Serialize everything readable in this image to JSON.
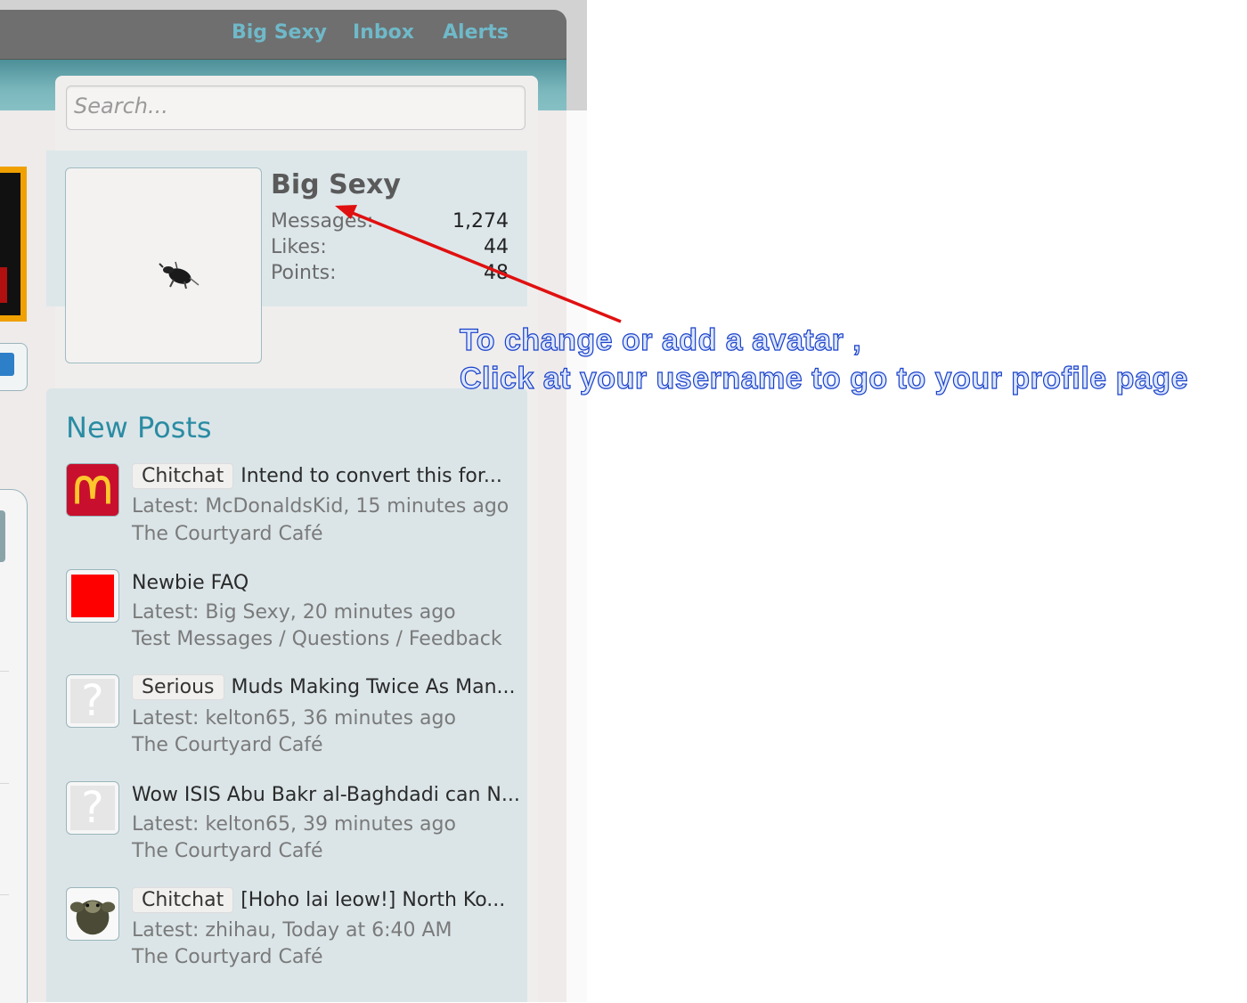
{
  "header": {
    "nav": [
      "Big Sexy",
      "Inbox",
      "Alerts"
    ]
  },
  "search": {
    "placeholder": "Search..."
  },
  "visitor": {
    "username": "Big Sexy",
    "stats": [
      {
        "label": "Messages:",
        "value": "1,274"
      },
      {
        "label": "Likes:",
        "value": "44"
      },
      {
        "label": "Points:",
        "value": "48"
      }
    ]
  },
  "new_posts": {
    "title": "New Posts",
    "items": [
      {
        "prefix": "Chitchat",
        "title": "Intend to convert this for...",
        "latest": "Latest: McDonaldsKid, 15 minutes ago",
        "forum": "The Courtyard Café",
        "avatar": "mcdonalds-logo"
      },
      {
        "prefix": "",
        "title": "Newbie FAQ",
        "latest": "Latest: Big Sexy, 20 minutes ago",
        "forum": "Test Messages / Questions / Feedback",
        "avatar": "red-square"
      },
      {
        "prefix": "Serious",
        "title": "Muds Making Twice As Man...",
        "latest": "Latest: kelton65, 36 minutes ago",
        "forum": "The Courtyard Café",
        "avatar": "default-avatar"
      },
      {
        "prefix": "",
        "title": "Wow ISIS Abu Bakr al-Baghdadi can N...",
        "latest": "Latest: kelton65, 39 minutes ago",
        "forum": "The Courtyard Café",
        "avatar": "default-avatar"
      },
      {
        "prefix": "Chitchat",
        "title": "[Hoho lai leow!] North Ko...",
        "latest": "Latest: zhihau, Today at 6:40 AM",
        "forum": "The Courtyard Café",
        "avatar": "creature-avatar"
      }
    ]
  },
  "annotation": {
    "line1": "To change or add a avatar ,",
    "line2": "Click at your username to go to your profile page",
    "arrow_color": "#e01010"
  },
  "colors": {
    "nav_link": "#6fb9c9",
    "accent": "#2b8ca3",
    "annotation_fill": "#dce7ff",
    "annotation_stroke": "#1a40c8"
  }
}
